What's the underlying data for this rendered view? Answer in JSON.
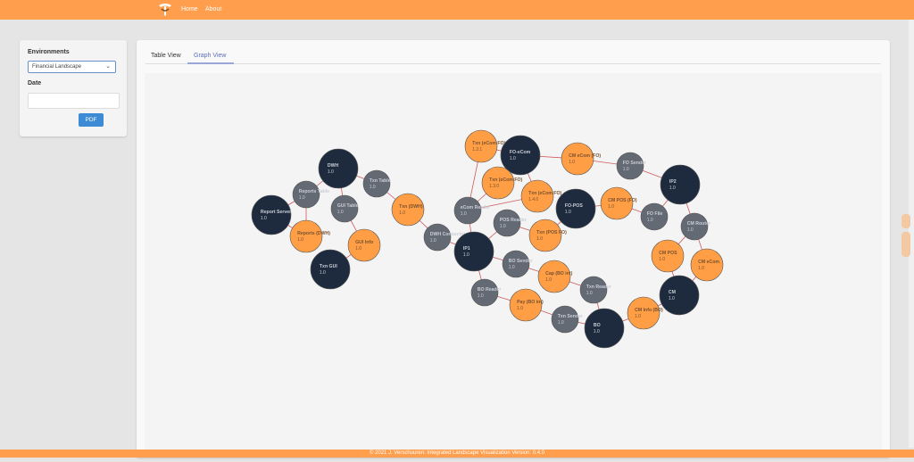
{
  "nav": {
    "home": "Home",
    "about": "About"
  },
  "sidebar": {
    "environments_label": "Environments",
    "environment_value": "Financial Landscape",
    "date_label": "Date",
    "date_value": "",
    "pdf_button": "PDF"
  },
  "tabs": [
    {
      "label": "Table View",
      "active": false
    },
    {
      "label": "Graph View",
      "active": true
    }
  ],
  "colors": {
    "dark_node": "#1e2b3e",
    "gray_node": "#636a74",
    "orange_node": "#ff9e45",
    "edge": "#cf5a5a",
    "brand": "#ff9e4d"
  },
  "graph": {
    "nodes": [
      {
        "id": "dwh",
        "name": "DWH",
        "version": "1.0",
        "kind": "dark"
      },
      {
        "id": "reports_table",
        "name": "Reports Table",
        "version": "1.0",
        "kind": "gray"
      },
      {
        "id": "txn_table",
        "name": "Txn Table",
        "version": "1.0",
        "kind": "gray"
      },
      {
        "id": "report_server",
        "name": "Report Server",
        "version": "1.0",
        "kind": "dark"
      },
      {
        "id": "gui_table",
        "name": "GUI Table",
        "version": "1.0",
        "kind": "gray"
      },
      {
        "id": "txn_dwh",
        "name": "Txn (DWH)",
        "version": "1.0",
        "kind": "orange"
      },
      {
        "id": "reports_dwh",
        "name": "Reports (DWH)",
        "version": "1.0",
        "kind": "orange"
      },
      {
        "id": "gui_info",
        "name": "GUI Info",
        "version": "1.0",
        "kind": "orange"
      },
      {
        "id": "txn_gui",
        "name": "Txn GUI",
        "version": "1.0",
        "kind": "dark"
      },
      {
        "id": "dwh_connector",
        "name": "DWH Connector",
        "version": "1.0",
        "kind": "gray"
      },
      {
        "id": "txn_ecom_fo",
        "name": "Txn (eCom FO)",
        "version": "1.3.1",
        "kind": "orange"
      },
      {
        "id": "fo_ecom",
        "name": "FO-eCom",
        "version": "1.0",
        "kind": "dark"
      },
      {
        "id": "cm_ecom_fo",
        "name": "CM eCom (FO)",
        "version": "1.0",
        "kind": "orange"
      },
      {
        "id": "fo_sender",
        "name": "FO Sender",
        "version": "1.0",
        "kind": "gray"
      },
      {
        "id": "ip2",
        "name": "IP2",
        "version": "1.0",
        "kind": "dark"
      },
      {
        "id": "txn_ecom_fo2",
        "name": "Txn (eCom FO)",
        "version": "1.3.0",
        "kind": "orange"
      },
      {
        "id": "txn_ecom_fo3",
        "name": "Txn (eCom FO)",
        "version": "1.4.0",
        "kind": "orange"
      },
      {
        "id": "ecom_reader",
        "name": "eCom Reader",
        "version": "1.0",
        "kind": "gray"
      },
      {
        "id": "fo_pos",
        "name": "FO-POS",
        "version": "1.0",
        "kind": "dark"
      },
      {
        "id": "cm_pos_fo",
        "name": "CM POS (FO)",
        "version": "1.0",
        "kind": "orange"
      },
      {
        "id": "fo_file",
        "name": "FO File",
        "version": "1.0",
        "kind": "gray"
      },
      {
        "id": "pos_reader",
        "name": "POS Reader",
        "version": "1.0",
        "kind": "gray"
      },
      {
        "id": "txn_pos_fo",
        "name": "Txn (POS FO)",
        "version": "1.0",
        "kind": "orange"
      },
      {
        "id": "cm_router",
        "name": "CM Router",
        "version": "1.0",
        "kind": "gray"
      },
      {
        "id": "ip1",
        "name": "IP1",
        "version": "1.0",
        "kind": "dark"
      },
      {
        "id": "cm_pos",
        "name": "CM POS",
        "version": "1.0",
        "kind": "orange"
      },
      {
        "id": "bo_sender",
        "name": "BO Sender",
        "version": "1.0",
        "kind": "gray"
      },
      {
        "id": "cm_ecom",
        "name": "CM eCom",
        "version": "1.0",
        "kind": "orange"
      },
      {
        "id": "cap_bo_int",
        "name": "Cap (BO int)",
        "version": "1.0",
        "kind": "orange"
      },
      {
        "id": "txn_reader",
        "name": "Txn Reader",
        "version": "1.0",
        "kind": "gray"
      },
      {
        "id": "bo_reader",
        "name": "BO Reader",
        "version": "1.0",
        "kind": "gray"
      },
      {
        "id": "cm",
        "name": "CM",
        "version": "1.0",
        "kind": "dark"
      },
      {
        "id": "pay_bo_int",
        "name": "Pay (BO int)",
        "version": "1.0",
        "kind": "orange"
      },
      {
        "id": "cm_info_bo",
        "name": "CM Info (BO)",
        "version": "1.0",
        "kind": "orange"
      },
      {
        "id": "txn_sender",
        "name": "Txn Sender",
        "version": "1.0",
        "kind": "gray"
      },
      {
        "id": "bo",
        "name": "BO",
        "version": "1.0",
        "kind": "dark"
      }
    ],
    "edges": [
      [
        "dwh",
        "reports_table"
      ],
      [
        "dwh",
        "txn_table"
      ],
      [
        "dwh",
        "gui_table"
      ],
      [
        "reports_table",
        "report_server"
      ],
      [
        "reports_table",
        "reports_dwh"
      ],
      [
        "txn_table",
        "txn_dwh"
      ],
      [
        "txn_dwh",
        "dwh_connector"
      ],
      [
        "gui_table",
        "gui_info"
      ],
      [
        "gui_info",
        "txn_gui"
      ],
      [
        "reports_dwh",
        "report_server"
      ],
      [
        "dwh_connector",
        "ip1"
      ],
      [
        "txn_ecom_fo",
        "fo_ecom"
      ],
      [
        "txn_ecom_fo",
        "ecom_reader"
      ],
      [
        "fo_ecom",
        "cm_ecom_fo"
      ],
      [
        "cm_ecom_fo",
        "fo_sender"
      ],
      [
        "fo_sender",
        "ip2"
      ],
      [
        "fo_ecom",
        "txn_ecom_fo2"
      ],
      [
        "fo_ecom",
        "txn_ecom_fo3"
      ],
      [
        "txn_ecom_fo2",
        "ecom_reader"
      ],
      [
        "txn_ecom_fo3",
        "ecom_reader"
      ],
      [
        "ecom_reader",
        "ip1"
      ],
      [
        "fo_pos",
        "cm_pos_fo"
      ],
      [
        "cm_pos_fo",
        "fo_file"
      ],
      [
        "fo_file",
        "ip2"
      ],
      [
        "fo_pos",
        "txn_pos_fo"
      ],
      [
        "txn_pos_fo",
        "pos_reader"
      ],
      [
        "pos_reader",
        "ip1"
      ],
      [
        "ip2",
        "cm_router"
      ],
      [
        "cm_router",
        "cm_pos"
      ],
      [
        "cm_router",
        "cm_ecom"
      ],
      [
        "cm_pos",
        "cm"
      ],
      [
        "cm_ecom",
        "cm"
      ],
      [
        "cm",
        "cm_info_bo"
      ],
      [
        "cm_info_bo",
        "bo"
      ],
      [
        "ip1",
        "bo_sender"
      ],
      [
        "bo_sender",
        "cap_bo_int"
      ],
      [
        "cap_bo_int",
        "txn_reader"
      ],
      [
        "ip1",
        "bo_reader"
      ],
      [
        "bo_reader",
        "pay_bo_int"
      ],
      [
        "pay_bo_int",
        "txn_sender"
      ],
      [
        "txn_sender",
        "bo"
      ],
      [
        "txn_reader",
        "bo"
      ]
    ]
  },
  "footer": {
    "text": "© 2021 J. Verschuuren: Integrated Landscape Visualization Version: 0.4.0"
  }
}
